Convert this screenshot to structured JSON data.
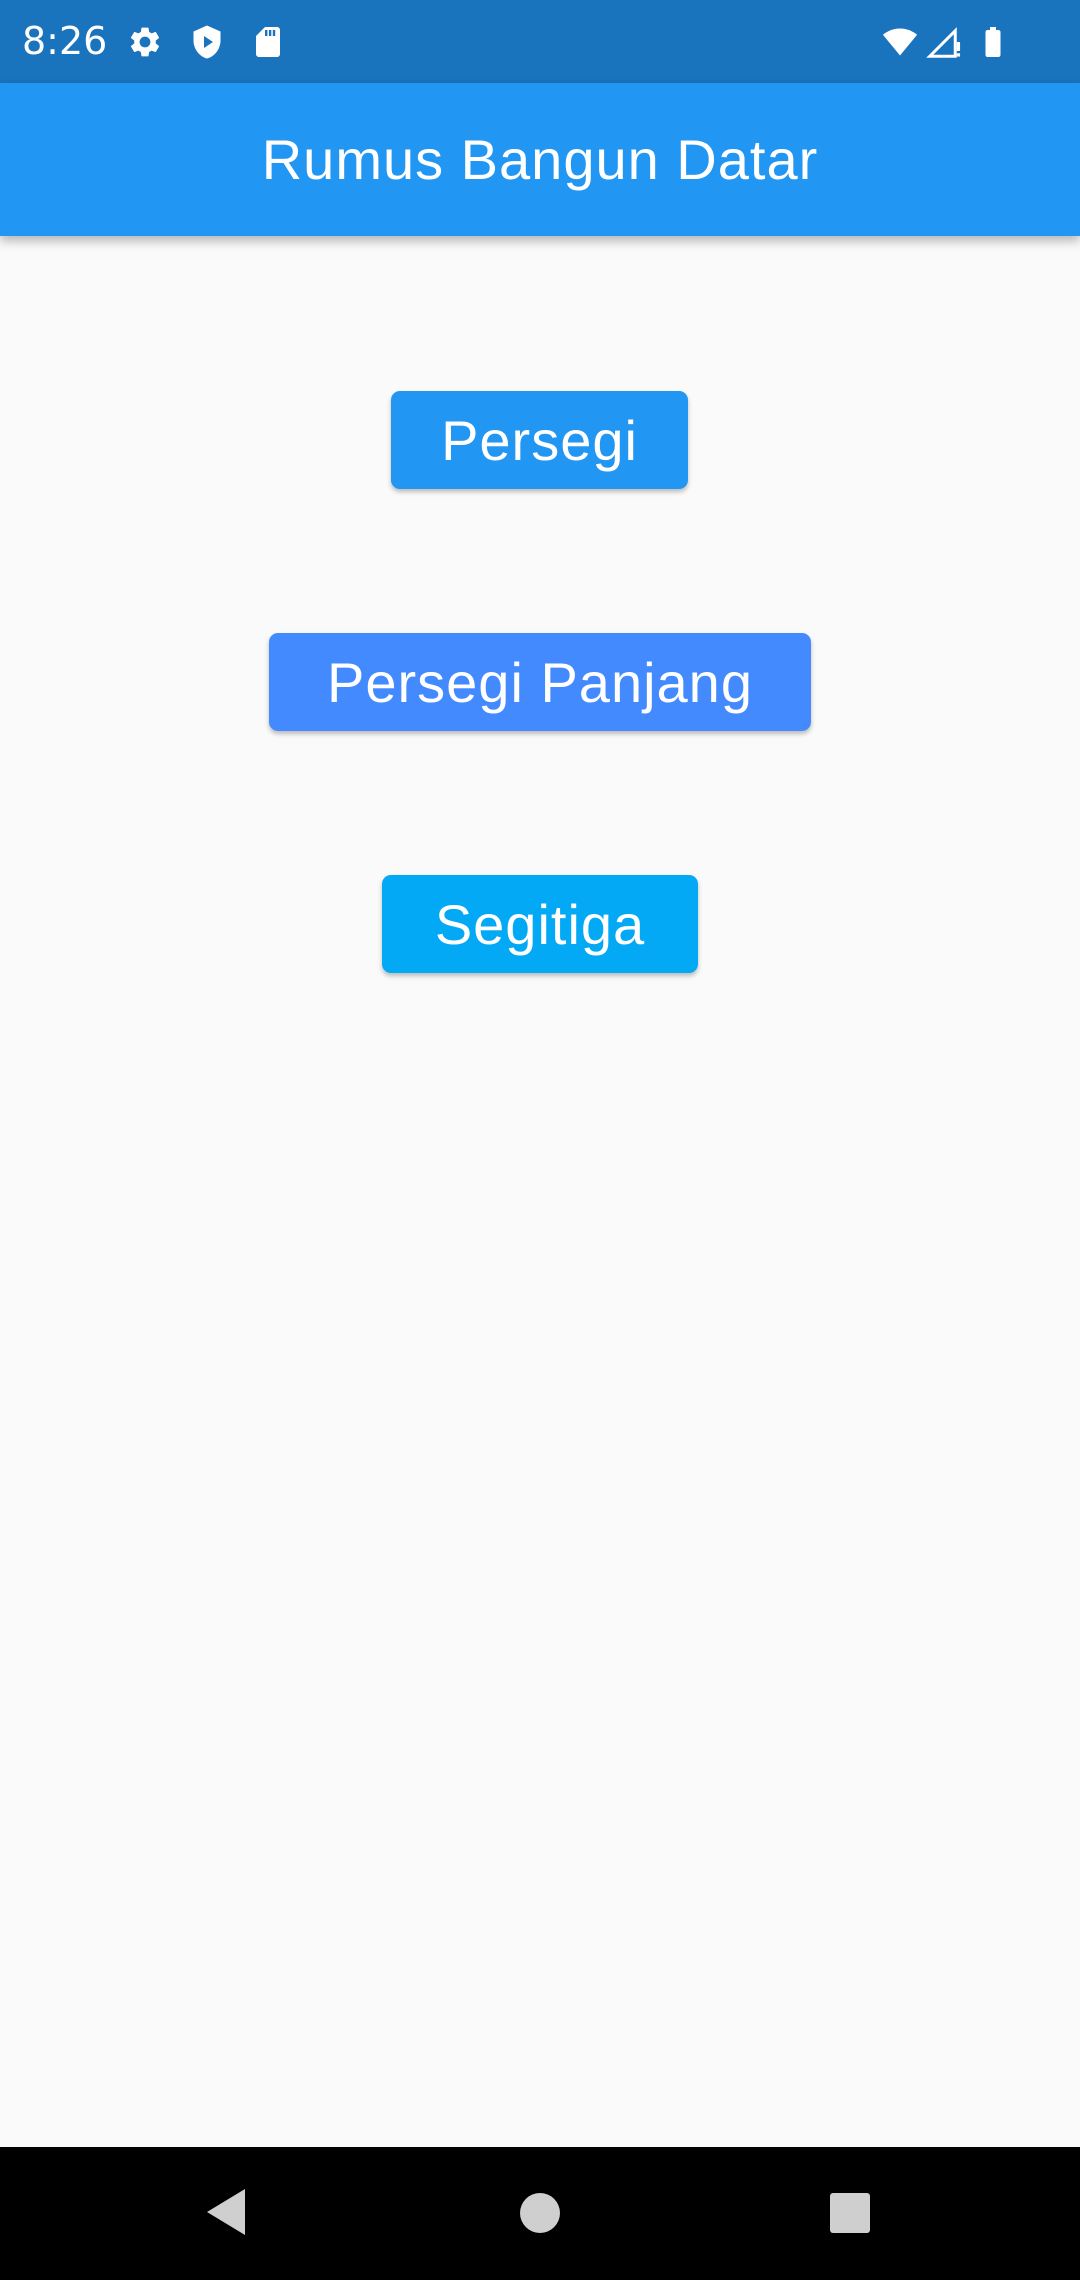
{
  "status_bar": {
    "time": "8:26",
    "left_icons": [
      "settings-icon",
      "play-protect-icon",
      "sd-card-icon"
    ],
    "right_icons": [
      "wifi-icon",
      "cell-signal-icon",
      "battery-icon"
    ]
  },
  "app_bar": {
    "title": "Rumus Bangun Datar"
  },
  "menu": {
    "buttons": [
      {
        "label": "Persegi",
        "color": "#2196f3"
      },
      {
        "label": "Persegi Panjang",
        "color": "#448aff"
      },
      {
        "label": "Segitiga",
        "color": "#03a9f4"
      }
    ]
  },
  "nav_bar": {
    "icons": [
      "back-icon",
      "home-icon",
      "recents-icon"
    ]
  },
  "colors": {
    "status_bar": "#1a73bd",
    "app_bar": "#2196f3",
    "background": "#fafafa"
  }
}
